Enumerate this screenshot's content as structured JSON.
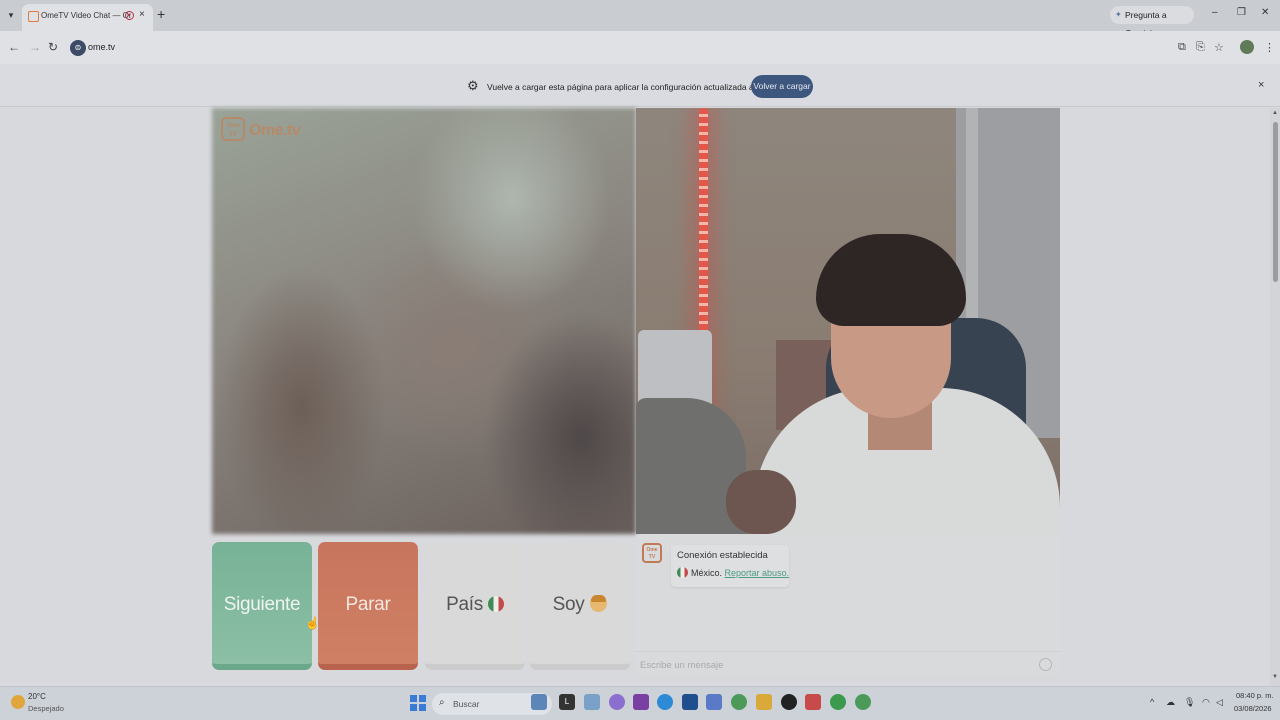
{
  "browser": {
    "tab_title": "OmeTV Video Chat — Omegle",
    "tab_close": "×",
    "new_tab": "+",
    "gemini_label": "Pregunta a Gemini",
    "window_minimize": "–",
    "window_restore": "❐",
    "window_close": "✕",
    "url": "ome.tv"
  },
  "infobar": {
    "message": "Vuelve a cargar esta página para aplicar la configuración actualizada a este sitio",
    "reload_label": "Volver a cargar",
    "close": "×"
  },
  "logo": {
    "box_text": "Ome TV",
    "text": "Ome.tv"
  },
  "controls": {
    "next_label": "Siguiente",
    "stop_label": "Parar",
    "country_label": "País",
    "gender_label": "Soy"
  },
  "chat": {
    "logo_text": "Ome TV",
    "status": "Conexión establecida",
    "country": "México.",
    "report_link": "Reportar abuso.",
    "input_placeholder": "Escribe un mensaje"
  },
  "taskbar": {
    "weather_temp": "20°C",
    "weather_desc": "Despejado",
    "search_placeholder": "Buscar",
    "time": "08:40 p. m.",
    "date": "03/08/2026"
  },
  "colors": {
    "next_green": "#77b297",
    "stop_red": "#c8755d",
    "reload_blue": "#3c567d",
    "report_link": "#4f9b84",
    "logo_brown": "#b48a6a"
  }
}
